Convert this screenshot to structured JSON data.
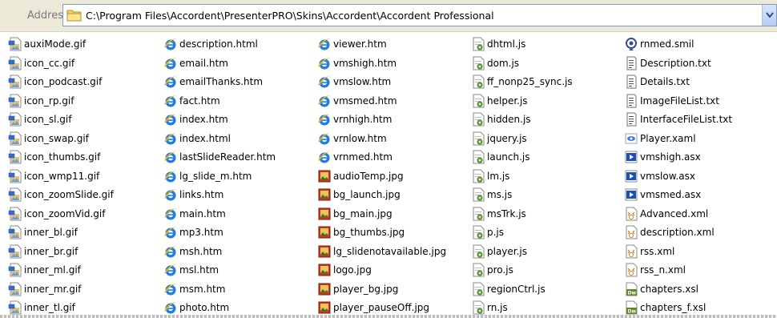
{
  "address": {
    "label": "Address",
    "path": "C:\\Program Files\\Accordent\\PresenterPRO\\Skins\\Accordent\\Accordent Professional"
  },
  "columns": [
    {
      "files": [
        {
          "name": "auxiMode.gif",
          "icon": "gif-image-icon"
        },
        {
          "name": "icon_cc.gif",
          "icon": "gif-image-icon"
        },
        {
          "name": "icon_podcast.gif",
          "icon": "gif-image-icon"
        },
        {
          "name": "icon_rp.gif",
          "icon": "gif-image-icon"
        },
        {
          "name": "icon_sl.gif",
          "icon": "gif-image-icon"
        },
        {
          "name": "icon_swap.gif",
          "icon": "gif-image-icon"
        },
        {
          "name": "icon_thumbs.gif",
          "icon": "gif-image-icon"
        },
        {
          "name": "icon_wmp11.gif",
          "icon": "gif-image-icon"
        },
        {
          "name": "icon_zoomSlide.gif",
          "icon": "gif-image-icon"
        },
        {
          "name": "icon_zoomVid.gif",
          "icon": "gif-image-icon"
        },
        {
          "name": "inner_bl.gif",
          "icon": "gif-image-icon"
        },
        {
          "name": "inner_br.gif",
          "icon": "gif-image-icon"
        },
        {
          "name": "inner_ml.gif",
          "icon": "gif-image-icon"
        },
        {
          "name": "inner_mr.gif",
          "icon": "gif-image-icon"
        },
        {
          "name": "inner_tl.gif",
          "icon": "gif-image-icon"
        }
      ]
    },
    {
      "files": [
        {
          "name": "description.html",
          "icon": "ie-html-icon"
        },
        {
          "name": "email.htm",
          "icon": "ie-html-icon"
        },
        {
          "name": "emailThanks.htm",
          "icon": "ie-html-icon"
        },
        {
          "name": "fact.htm",
          "icon": "ie-html-icon"
        },
        {
          "name": "index.htm",
          "icon": "ie-html-icon"
        },
        {
          "name": "index.html",
          "icon": "ie-html-icon"
        },
        {
          "name": "lastSlideReader.htm",
          "icon": "ie-html-icon"
        },
        {
          "name": "lg_slide_m.htm",
          "icon": "ie-html-icon"
        },
        {
          "name": "links.htm",
          "icon": "ie-html-icon"
        },
        {
          "name": "main.htm",
          "icon": "ie-html-icon"
        },
        {
          "name": "mp3.htm",
          "icon": "ie-html-icon"
        },
        {
          "name": "msh.htm",
          "icon": "ie-html-icon"
        },
        {
          "name": "msl.htm",
          "icon": "ie-html-icon"
        },
        {
          "name": "msm.htm",
          "icon": "ie-html-icon"
        },
        {
          "name": "photo.htm",
          "icon": "ie-html-icon"
        }
      ]
    },
    {
      "files": [
        {
          "name": "viewer.htm",
          "icon": "ie-html-icon"
        },
        {
          "name": "vmshigh.htm",
          "icon": "ie-html-icon"
        },
        {
          "name": "vmslow.htm",
          "icon": "ie-html-icon"
        },
        {
          "name": "vmsmed.htm",
          "icon": "ie-html-icon"
        },
        {
          "name": "vrnhigh.htm",
          "icon": "ie-html-icon"
        },
        {
          "name": "vrnlow.htm",
          "icon": "ie-html-icon"
        },
        {
          "name": "vrnmed.htm",
          "icon": "ie-html-icon"
        },
        {
          "name": "audioTemp.jpg",
          "icon": "jpg-image-icon"
        },
        {
          "name": "bg_launch.jpg",
          "icon": "jpg-image-icon"
        },
        {
          "name": "bg_main.jpg",
          "icon": "jpg-image-icon"
        },
        {
          "name": "bg_thumbs.jpg",
          "icon": "jpg-image-icon"
        },
        {
          "name": "lg_slidenotavailable.jpg",
          "icon": "jpg-image-icon"
        },
        {
          "name": "logo.jpg",
          "icon": "jpg-image-icon"
        },
        {
          "name": "player_bg.jpg",
          "icon": "jpg-image-icon"
        },
        {
          "name": "player_pauseOff.jpg",
          "icon": "jpg-image-icon"
        }
      ]
    },
    {
      "files": [
        {
          "name": "dhtml.js",
          "icon": "js-script-icon"
        },
        {
          "name": "dom.js",
          "icon": "js-script-icon"
        },
        {
          "name": "ff_nonp25_sync.js",
          "icon": "js-script-icon"
        },
        {
          "name": "helper.js",
          "icon": "js-script-icon"
        },
        {
          "name": "hidden.js",
          "icon": "js-script-icon"
        },
        {
          "name": "jquery.js",
          "icon": "js-script-icon"
        },
        {
          "name": "launch.js",
          "icon": "js-script-icon"
        },
        {
          "name": "lm.js",
          "icon": "js-script-icon"
        },
        {
          "name": "ms.js",
          "icon": "js-script-icon"
        },
        {
          "name": "msTrk.js",
          "icon": "js-script-icon"
        },
        {
          "name": "p.js",
          "icon": "js-script-icon"
        },
        {
          "name": "player.js",
          "icon": "js-script-icon"
        },
        {
          "name": "pro.js",
          "icon": "js-script-icon"
        },
        {
          "name": "regionCtrl.js",
          "icon": "js-script-icon"
        },
        {
          "name": "rn.js",
          "icon": "js-script-icon"
        }
      ]
    },
    {
      "files": [
        {
          "name": "rnmed.smil",
          "icon": "smil-icon"
        },
        {
          "name": "Description.txt",
          "icon": "text-file-icon"
        },
        {
          "name": "Details.txt",
          "icon": "text-file-icon"
        },
        {
          "name": "ImageFileList.txt",
          "icon": "text-file-icon"
        },
        {
          "name": "InterfaceFileList.txt",
          "icon": "text-file-icon"
        },
        {
          "name": "Player.xaml",
          "icon": "xaml-icon"
        },
        {
          "name": "vmshigh.asx",
          "icon": "asx-media-icon"
        },
        {
          "name": "vmslow.asx",
          "icon": "asx-media-icon"
        },
        {
          "name": "vmsmed.asx",
          "icon": "asx-media-icon"
        },
        {
          "name": "Advanced.xml",
          "icon": "xml-file-icon"
        },
        {
          "name": "description.xml",
          "icon": "xml-file-icon"
        },
        {
          "name": "rss.xml",
          "icon": "xml-file-icon"
        },
        {
          "name": "rss_n.xml",
          "icon": "xml-file-icon"
        },
        {
          "name": "chapters.xsl",
          "icon": "xsl-dreamweaver-icon"
        },
        {
          "name": "chapters_f.xsl",
          "icon": "xsl-dreamweaver-icon"
        }
      ]
    }
  ]
}
